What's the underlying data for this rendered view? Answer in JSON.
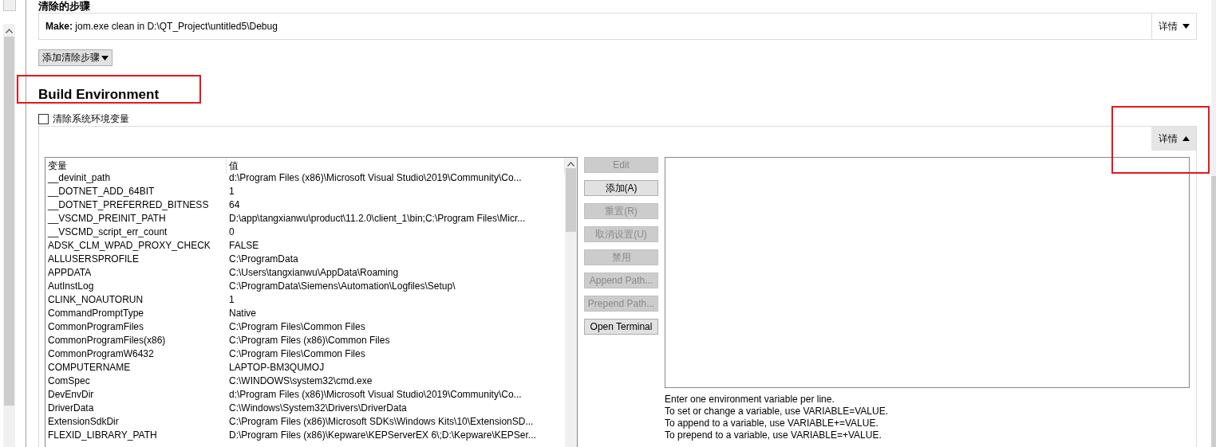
{
  "clean_steps": {
    "heading": "清除的步骤",
    "steps": [
      {
        "label": "Make:",
        "command": "jom.exe clean in D:\\QT_Project\\untitled5\\Debug",
        "details": {
          "label": "详情",
          "expanded": false
        }
      }
    ],
    "add_button": "添加清除步骤"
  },
  "build_environment": {
    "title": "Build Environment",
    "clear_system_env": {
      "label": "清除系统环境变量",
      "checked": false
    },
    "details": {
      "label": "详情",
      "expanded": true
    },
    "table": {
      "columns": [
        "变量",
        "值"
      ],
      "rows": [
        [
          "__devinit_path",
          "d:\\Program Files (x86)\\Microsoft Visual Studio\\2019\\Community\\Co..."
        ],
        [
          "__DOTNET_ADD_64BIT",
          "1"
        ],
        [
          "__DOTNET_PREFERRED_BITNESS",
          "64"
        ],
        [
          "__VSCMD_PREINIT_PATH",
          "D:\\app\\tangxianwu\\product\\11.2.0\\client_1\\bin;C:\\Program Files\\Micr..."
        ],
        [
          "__VSCMD_script_err_count",
          "0"
        ],
        [
          "ADSK_CLM_WPAD_PROXY_CHECK",
          "FALSE"
        ],
        [
          "ALLUSERSPROFILE",
          "C:\\ProgramData"
        ],
        [
          "APPDATA",
          "C:\\Users\\tangxianwu\\AppData\\Roaming"
        ],
        [
          "AutInstLog",
          "C:\\ProgramData\\Siemens\\Automation\\Logfiles\\Setup\\"
        ],
        [
          "CLINK_NOAUTORUN",
          "1"
        ],
        [
          "CommandPromptType",
          "Native"
        ],
        [
          "CommonProgramFiles",
          "C:\\Program Files\\Common Files"
        ],
        [
          "CommonProgramFiles(x86)",
          "C:\\Program Files (x86)\\Common Files"
        ],
        [
          "CommonProgramW6432",
          "C:\\Program Files\\Common Files"
        ],
        [
          "COMPUTERNAME",
          "LAPTOP-BM3QUMOJ"
        ],
        [
          "ComSpec",
          "C:\\WINDOWS\\system32\\cmd.exe"
        ],
        [
          "DevEnvDir",
          "d:\\Program Files (x86)\\Microsoft Visual Studio\\2019\\Community\\Co..."
        ],
        [
          "DriverData",
          "C:\\Windows\\System32\\Drivers\\DriverData"
        ],
        [
          "ExtensionSdkDir",
          "C:\\Program Files (x86)\\Microsoft SDKs\\Windows Kits\\10\\ExtensionSD..."
        ],
        [
          "FLEXID_LIBRARY_PATH",
          "D:\\Program Files (x86)\\Kepware\\KEPServerEX 6\\;D:\\Kepware\\KEPSer..."
        ]
      ]
    },
    "buttons": [
      {
        "label": "Edit",
        "disabled": true
      },
      {
        "label": "添加(A)",
        "disabled": false
      },
      {
        "label": "重置(R)",
        "disabled": true
      },
      {
        "label": "取消设置(U)",
        "disabled": true
      },
      {
        "label": "禁用",
        "disabled": true
      },
      {
        "label": "Append Path...",
        "disabled": true
      },
      {
        "label": "Prepend Path...",
        "disabled": true
      },
      {
        "label": "Open Terminal",
        "disabled": false
      }
    ],
    "help_lines": [
      "Enter one environment variable per line.",
      "To set or change a variable, use VARIABLE=VALUE.",
      "To append to a variable, use VARIABLE+=VALUE.",
      "To prepend to a variable, use VARIABLE=+VALUE."
    ]
  }
}
